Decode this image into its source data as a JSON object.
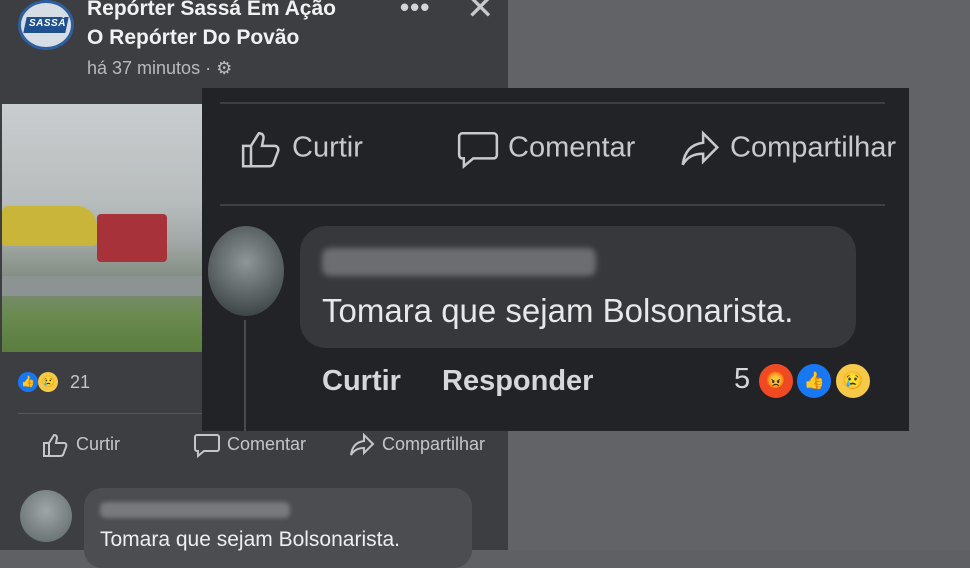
{
  "post": {
    "page_name_line1": "Repórter Sassá Em Ação",
    "page_name_line2": "O Repórter Do Povão",
    "logo_text": "SASSÁ",
    "time": "há 37 minutos · ⚙",
    "menu_icon": "more-dots-icon",
    "close_icon": "close-icon",
    "reaction_count": "21",
    "actions": {
      "like": "Curtir",
      "comment": "Comentar",
      "share": "Compartilhar"
    },
    "comment_text": "Tomara que sejam Bolsonarista."
  },
  "overlay": {
    "actions": {
      "like": "Curtir",
      "comment": "Comentar",
      "share": "Compartilhar"
    },
    "comment_text": "Tomara que sejam Bolsonarista.",
    "comment_like": "Curtir",
    "comment_reply": "Responder",
    "reaction_count": "5"
  },
  "colors": {
    "like_blue": "#1877f2",
    "angry_orange": "#f04a25",
    "sad_yellow": "#f7c948"
  }
}
